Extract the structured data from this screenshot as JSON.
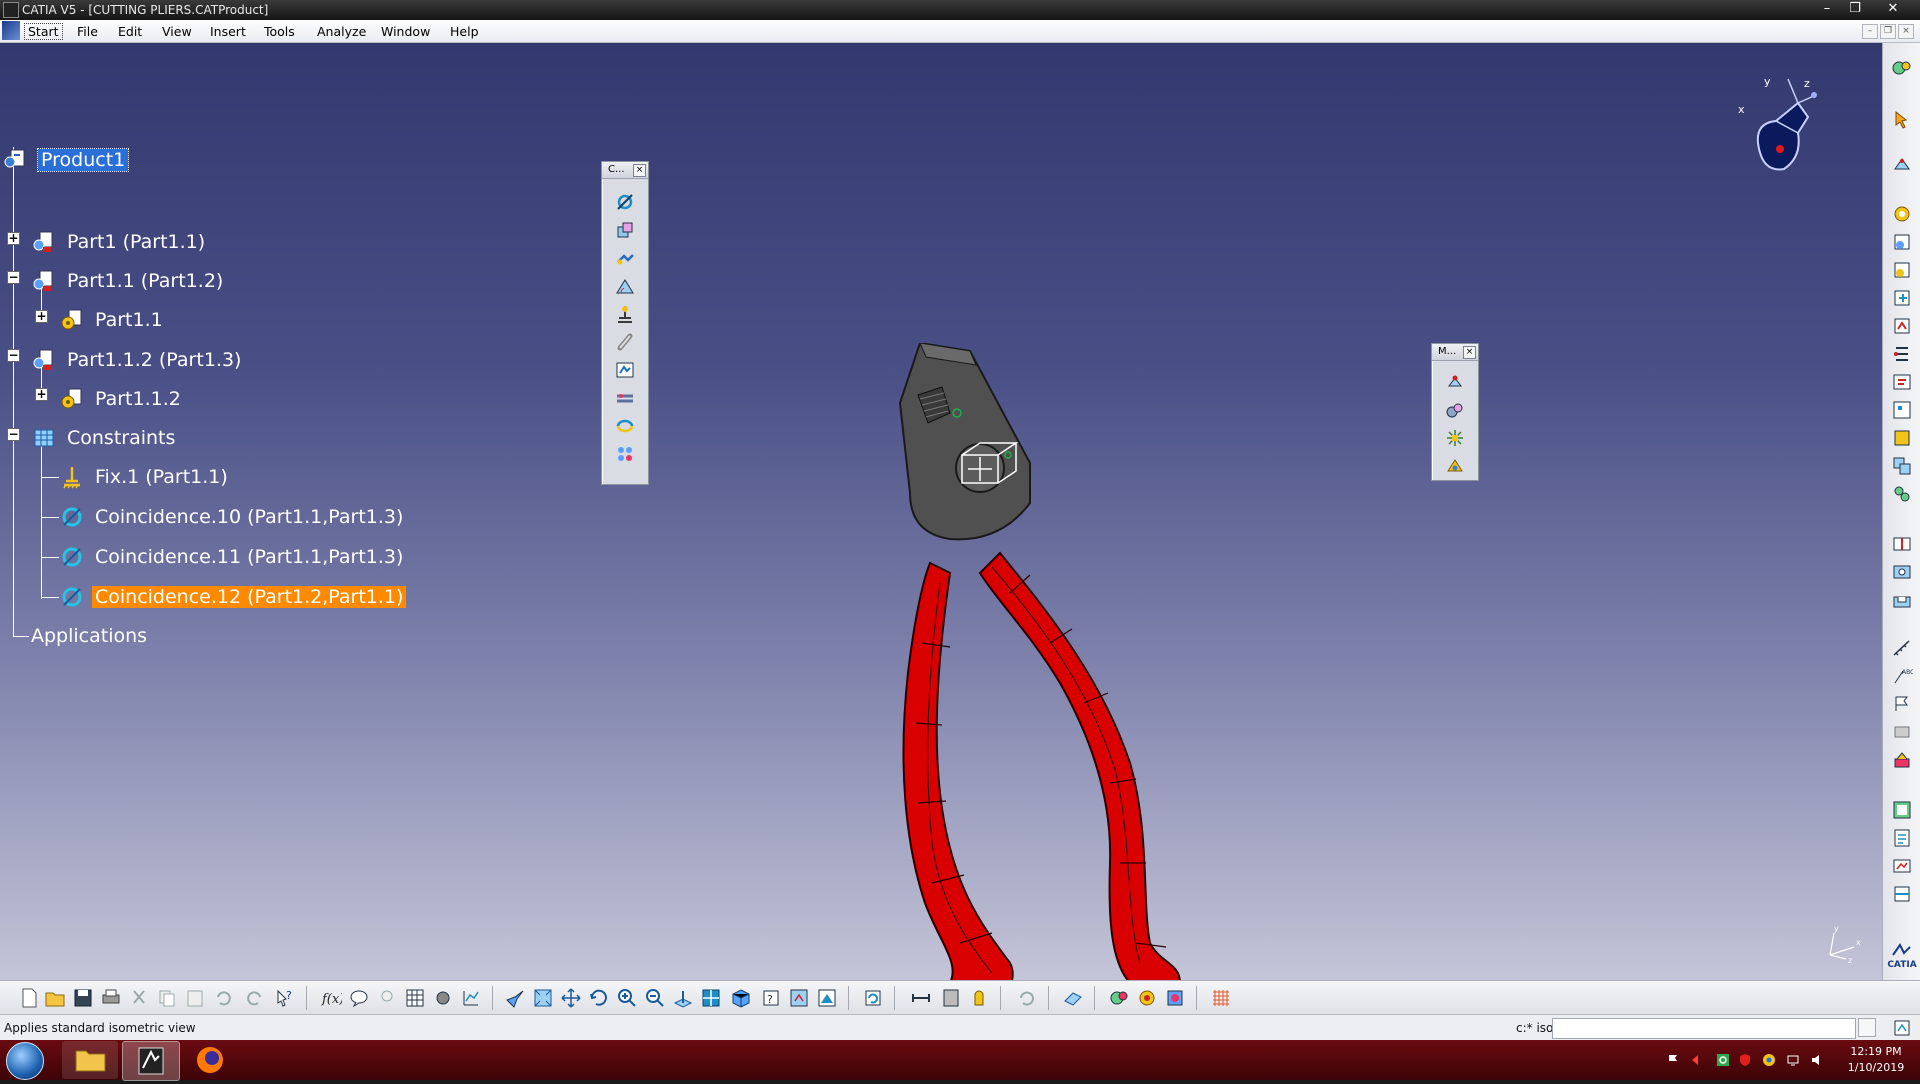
{
  "window": {
    "title": "CATIA V5 - [CUTTING PLIERS.CATProduct]",
    "controls": [
      "minimize",
      "restore",
      "close"
    ]
  },
  "menu": {
    "items": [
      "Start",
      "File",
      "Edit",
      "View",
      "Insert",
      "Tools",
      "Analyze",
      "Window",
      "Help"
    ],
    "active": "Start"
  },
  "tree": {
    "root": "Product1",
    "nodes": [
      {
        "label": "Part1 (Part1.1)",
        "icon": "part-instance-icon"
      },
      {
        "label": "Part1.1 (Part1.2)",
        "icon": "part-instance-icon"
      },
      {
        "label": "Part1.1",
        "icon": "part-gear-icon"
      },
      {
        "label": "Part1.1.2 (Part1.3)",
        "icon": "part-instance-icon"
      },
      {
        "label": "Part1.1.2",
        "icon": "part-gear-icon"
      },
      {
        "label": "Constraints",
        "icon": "constraints-icon"
      },
      {
        "label": "Fix.1 (Part1.1)",
        "icon": "fix-constraint-icon"
      },
      {
        "label": "Coincidence.10 (Part1.1,Part1.3)",
        "icon": "coincidence-icon"
      },
      {
        "label": "Coincidence.11 (Part1.1,Part1.3)",
        "icon": "coincidence-icon"
      },
      {
        "label": "Coincidence.12 (Part1.2,Part1.1)",
        "icon": "coincidence-icon",
        "selected": true
      }
    ],
    "applications": "Applications"
  },
  "toolbars": {
    "constraints": {
      "caption": "C...",
      "close": "×"
    },
    "move": {
      "caption": "M...",
      "close": "×"
    }
  },
  "compass": {
    "x": "x",
    "y": "y",
    "z": "z"
  },
  "axis_triad": {
    "x": "x",
    "y": "y",
    "z": "z"
  },
  "colors": {
    "handle_red": "#d80000",
    "selection_orange": "#ff8a00",
    "selection_blue": "#2a6fd8",
    "viewport_top": "#33386f",
    "viewport_bottom": "#c4c5d8"
  },
  "brand": "CATIA",
  "status": {
    "message": "Applies standard isometric view",
    "command_label": "c:* iso",
    "command_value": ""
  },
  "taskbar": {
    "time": "12:19 PM",
    "date": "1/10/2019"
  }
}
